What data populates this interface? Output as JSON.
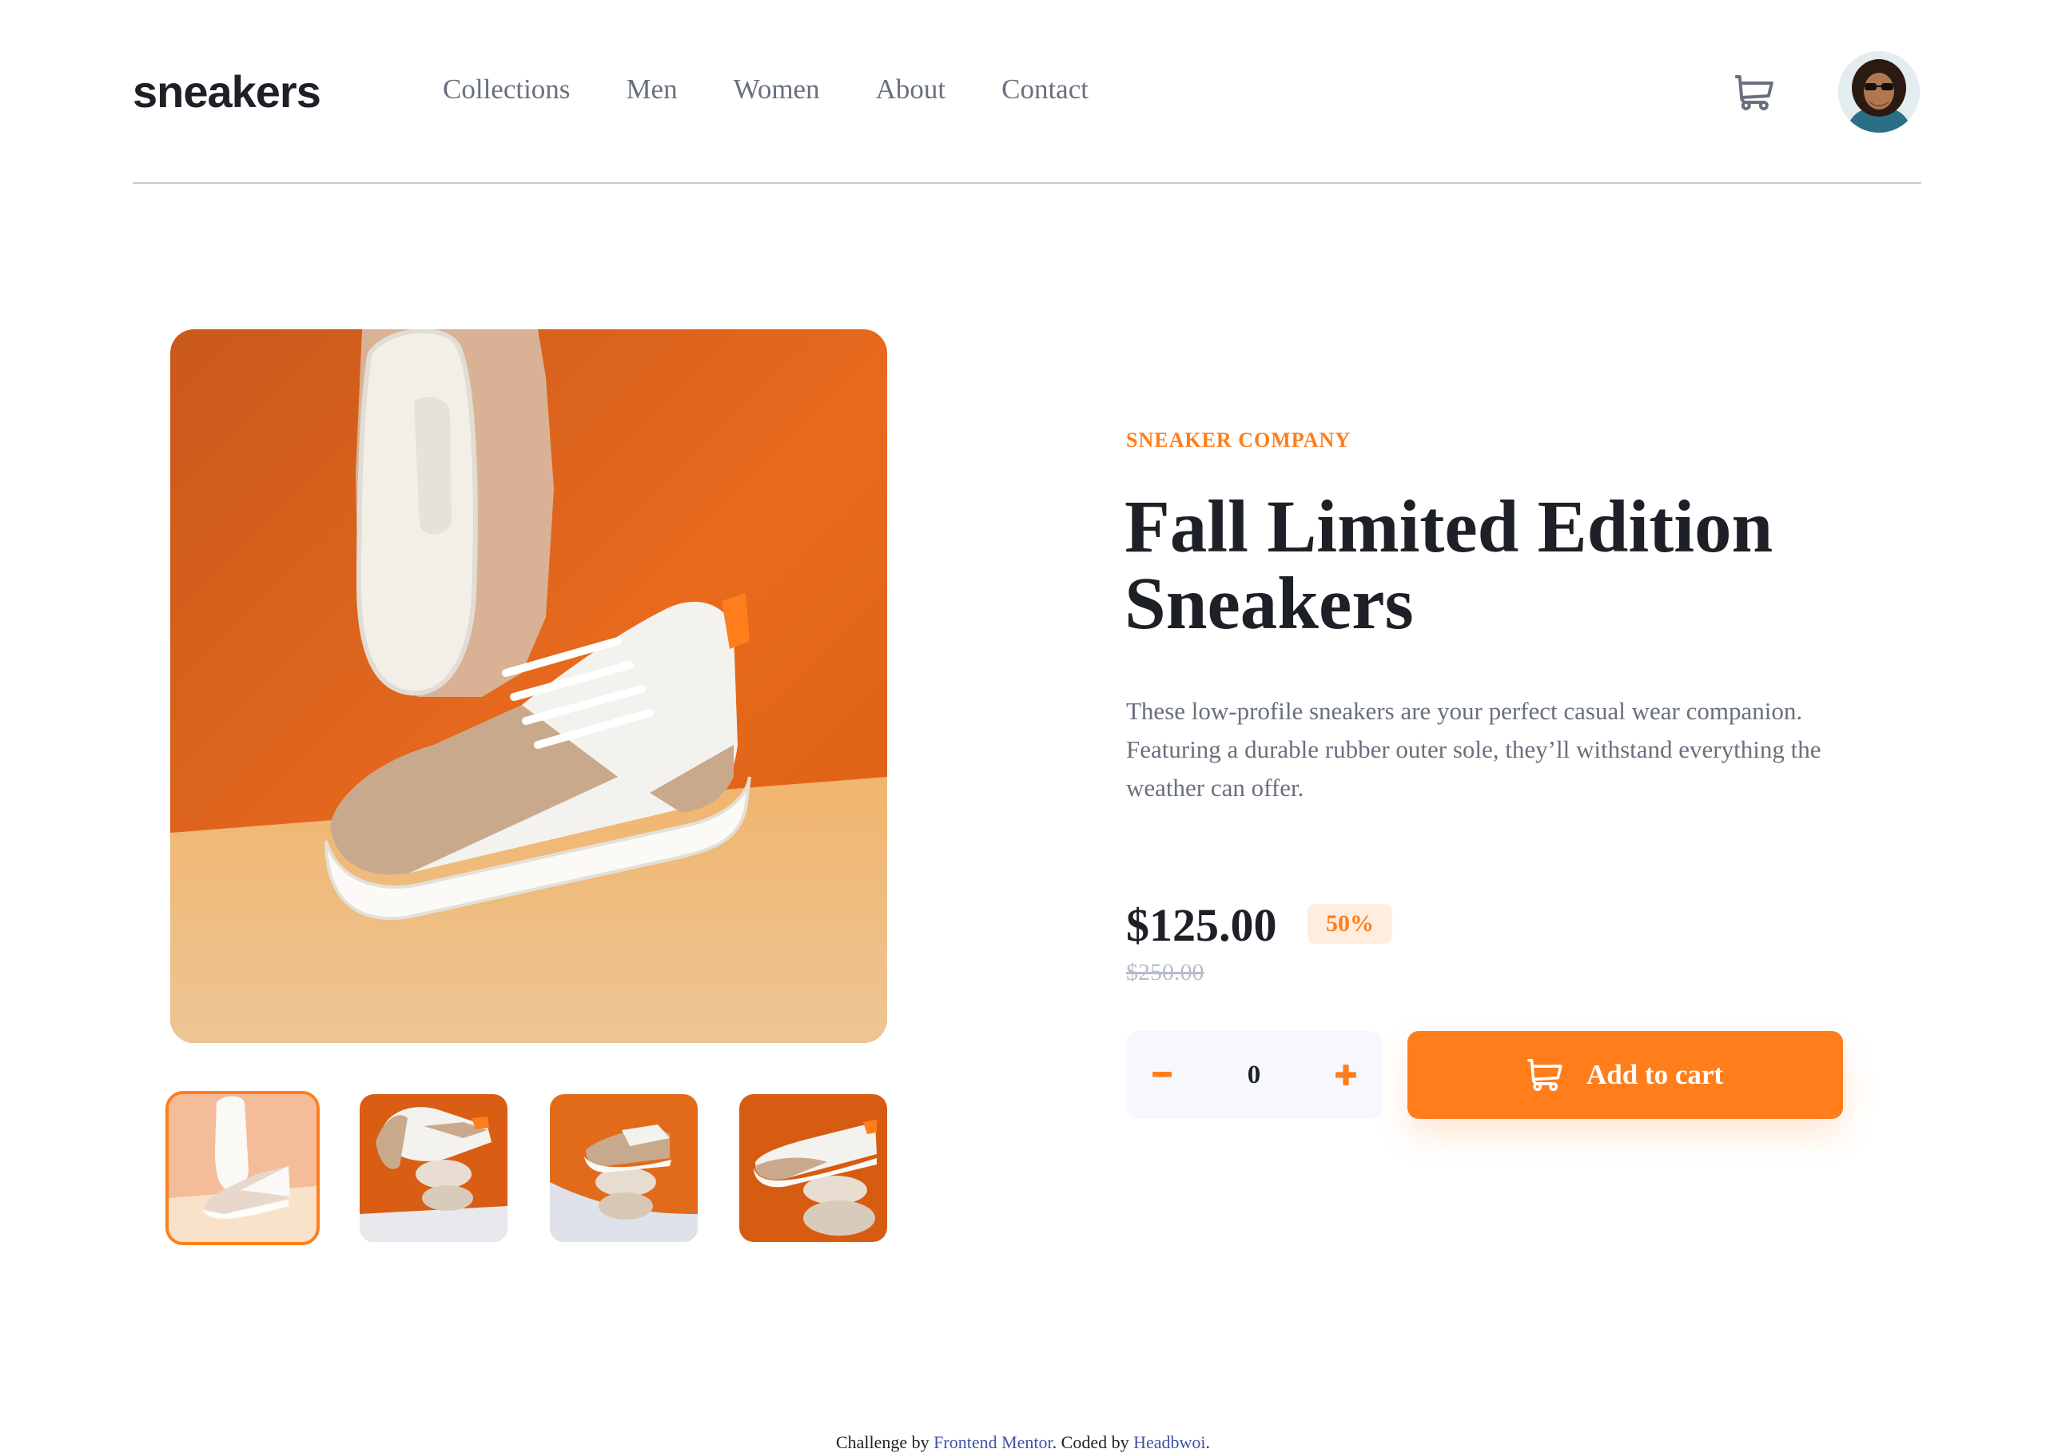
{
  "header": {
    "logo": "sneakers",
    "nav": [
      "Collections",
      "Men",
      "Women",
      "About",
      "Contact"
    ],
    "cart_icon": "cart-icon",
    "avatar_icon": "user-avatar"
  },
  "gallery": {
    "main_image": "white-sneaker-with-sole-on-orange-background",
    "thumbnails": [
      {
        "name": "thumbnail-1",
        "active": true
      },
      {
        "name": "thumbnail-2",
        "active": false
      },
      {
        "name": "thumbnail-3",
        "active": false
      },
      {
        "name": "thumbnail-4",
        "active": false
      }
    ]
  },
  "product": {
    "company": "SNEAKER COMPANY",
    "title": "Fall Limited Edition Sneakers",
    "description": "These low-profile sneakers are your perfect casual wear companion. Featuring a durable rubber outer sole, they’ll withstand everything the weather can offer.",
    "price": "$125.00",
    "discount": "50%",
    "old_price": "$250.00"
  },
  "cart_controls": {
    "quantity": "0",
    "add_label": "Add to cart"
  },
  "footer": {
    "prefix": "Challenge by ",
    "link1": "Frontend Mentor",
    "middle": ". Coded by ",
    "link2": "Headbwoi",
    "suffix": "."
  },
  "colors": {
    "accent": "#ff7e1b",
    "accent_pale": "#ffede0",
    "text_dark": "#1d2026",
    "text_gray": "#69707d"
  }
}
